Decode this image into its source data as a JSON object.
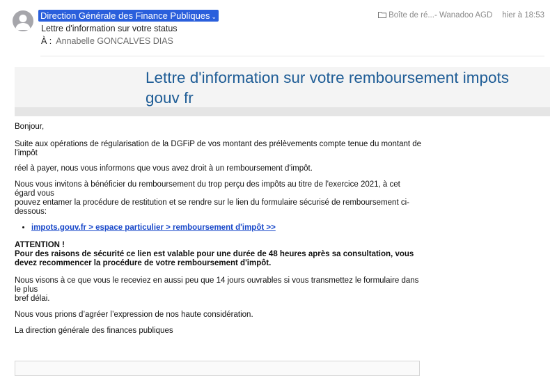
{
  "header": {
    "sender": "Direction Générale des Finance Publiques",
    "subject": "Lettre d'information sur votre status",
    "to_label": "À :",
    "to_name": "Annabelle GONCALVES DIAS",
    "folder_icon": "folder-icon",
    "folder": "Boîte de ré...- Wanadoo AGD",
    "time": "hier à 18:53",
    "colors": {
      "sender_highlight": "#2a5fdc"
    }
  },
  "email": {
    "banner_title": "Lettre d'information sur votre remboursement  impots gouv fr",
    "greeting": "Bonjour,",
    "para1_line1": "Suite aux opérations de régularisation de la DGFiP de vos montant des prélèvements compte tenue du montant de l'impôt",
    "para1_line2": "réel à payer, nous vous informons que vous avez droit à un remboursement d'impôt.",
    "para2_line1": "Nous vous invitons à bénéficier du remboursement du trop perçu des impôts au titre de l'exercice 2021, à cet égard vous",
    "para2_line2": "pouvez entamer la procédure de restitution et se rendre sur le lien du formulaire sécurisé de remboursement ci-dessous:",
    "link": "impots.gouv.fr > espace particulier > remboursement d'impôt >>",
    "attention_title": "ATTENTION !",
    "attention_text": "Pour des raisons de sécurité ce lien est valable pour une durée de 48 heures après sa consultation, vous devez recommencer la procédure de votre remboursement d'impôt.",
    "para3_line1": "Nous visons à ce que vous le receviez en aussi peu que 14 jours ouvrables si vous transmettez le formulaire dans le plus",
    "para3_line2": "bref délai.",
    "closing": "Nous vous prions d’agréer l’expression de nos haute considération.",
    "signature": "La direction générale des finances publiques",
    "colors": {
      "title": "#1f5d96",
      "link": "#1747c9"
    }
  }
}
